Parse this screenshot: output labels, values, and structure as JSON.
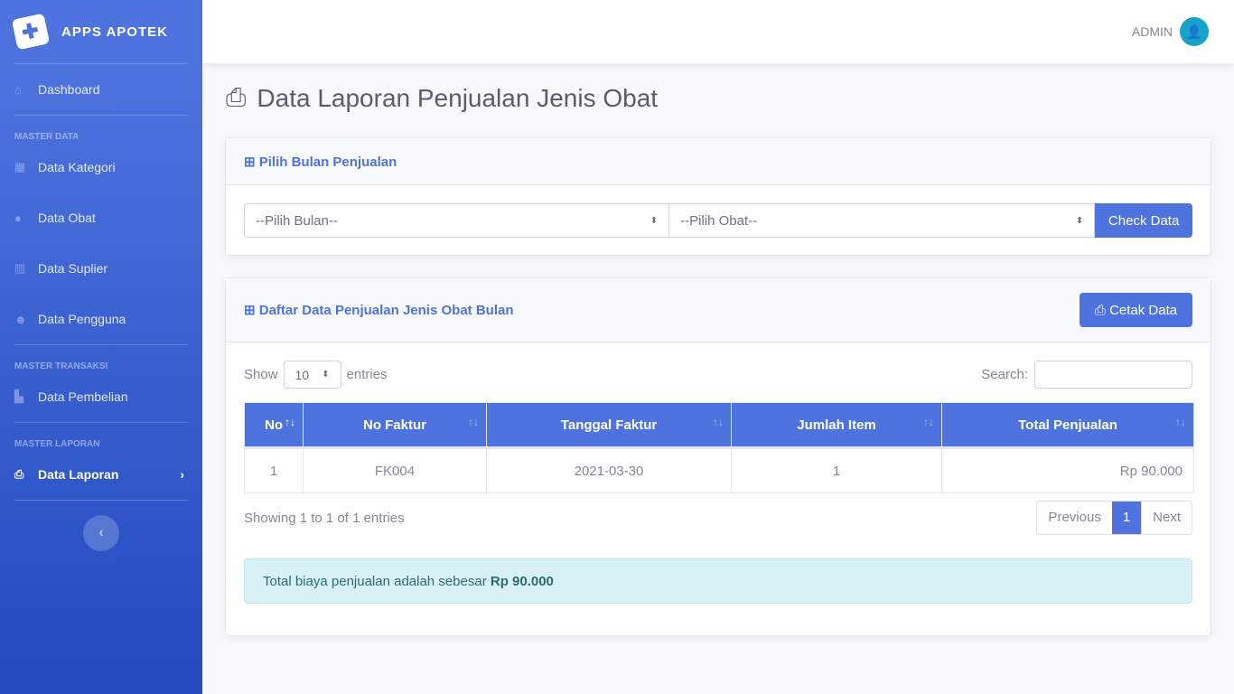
{
  "brand": "APPS APOTEK",
  "sidebar": {
    "dashboard": "Dashboard",
    "h1": "MASTER DATA",
    "kategori": "Data Kategori",
    "obat": "Data Obat",
    "suplier": "Data Suplier",
    "pengguna": "Data Pengguna",
    "h2": "MASTER TRANSAKSI",
    "pembelian": "Data Pembelian",
    "h3": "MASTER LAPORAN",
    "laporan": "Data Laporan"
  },
  "topbar": {
    "user": "ADMIN"
  },
  "page_title": "Data Laporan Penjualan Jenis Obat",
  "filter": {
    "title": "Pilih Bulan Penjualan",
    "bulan": "--Pilih Bulan--",
    "obat": "--Pilih Obat--",
    "check": "Check Data"
  },
  "list": {
    "title": "Daftar Data Penjualan Jenis Obat Bulan",
    "cetak": "Cetak Data",
    "show": "Show",
    "entries_value": "10",
    "entries": "entries",
    "search": "Search:",
    "columns": [
      "No",
      "No Faktur",
      "Tanggal Faktur",
      "Jumlah Item",
      "Total Penjualan"
    ],
    "rows": [
      [
        "1",
        "FK004",
        "2021-03-30",
        "1",
        "Rp 90.000"
      ]
    ],
    "info": "Showing 1 to 1 of 1 entries",
    "prev": "Previous",
    "page": "1",
    "next": "Next",
    "total_text": "Total biaya penjualan adalah sebesar",
    "total_value": "Rp 90.000"
  },
  "colors": {
    "primary": "#4e73df",
    "alert_bg": "#d7f1f5"
  }
}
